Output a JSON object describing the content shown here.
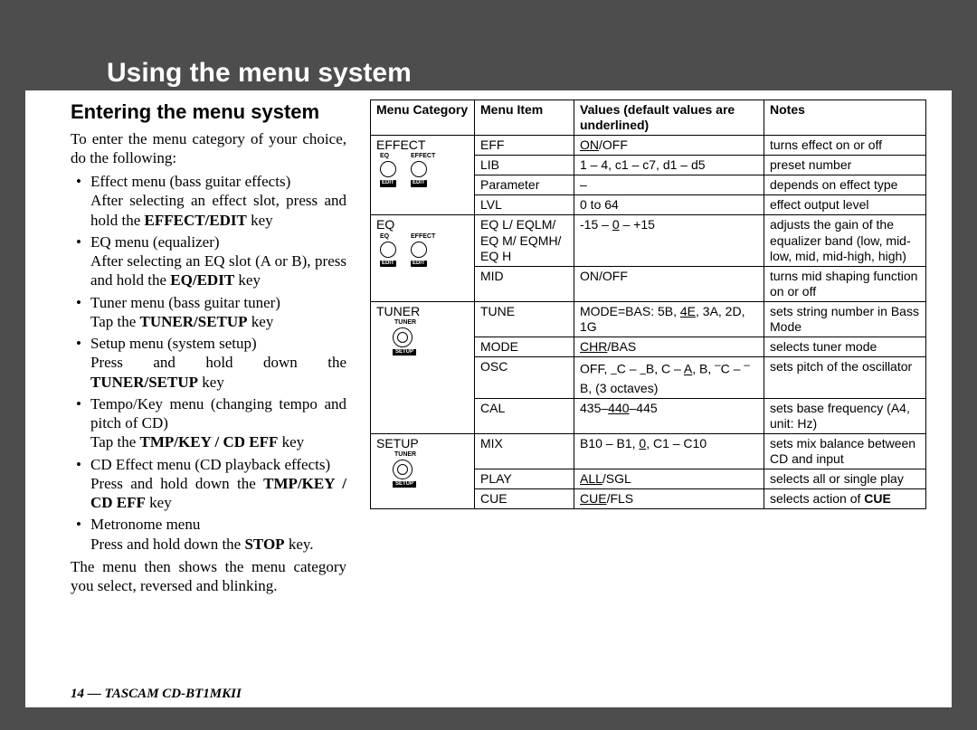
{
  "title": "Using the menu system",
  "section_heading": "Entering the menu system",
  "intro": "To enter the menu category of your choice, do the following:",
  "bullets": [
    {
      "head": "Effect menu (bass guitar effects)",
      "sub_pre": "After selecting an effect slot, press and hold the ",
      "sub_bold": "EFFECT/EDIT",
      "sub_post": " key"
    },
    {
      "head": "EQ menu (equalizer)",
      "sub_pre": "After selecting an EQ slot (A or B), press and hold the ",
      "sub_bold": "EQ/EDIT",
      "sub_post": " key"
    },
    {
      "head": "Tuner menu (bass guitar tuner)",
      "sub_pre": "Tap the ",
      "sub_bold": "TUNER/SETUP",
      "sub_post": " key"
    },
    {
      "head": "Setup menu (system setup)",
      "sub_pre": "Press and hold down the ",
      "sub_bold": "TUNER/SETUP",
      "sub_post": " key"
    },
    {
      "head": "Tempo/Key menu (changing tempo and pitch of CD)",
      "sub_pre": "Tap the ",
      "sub_bold": "TMP/KEY / CD EFF",
      "sub_post": " key"
    },
    {
      "head": "CD Effect menu (CD playback effects)",
      "sub_pre": "Press and hold down the ",
      "sub_bold": "TMP/KEY / CD EFF",
      "sub_post": " key"
    },
    {
      "head": "Metronome menu",
      "sub_pre": "Press and hold down the ",
      "sub_bold": "STOP",
      "sub_post": " key."
    }
  ],
  "outro": "The menu then shows the menu category you select, reversed and blinking.",
  "footer": {
    "page_num": "14",
    "sep": " — ",
    "product": "TASCAM CD-BT1MKII"
  },
  "table": {
    "headers": {
      "cat": "Menu Category",
      "item": "Menu Item",
      "values": "Values (default values are underlined)",
      "notes": "Notes"
    },
    "groups": [
      {
        "category": "EFFECT",
        "icon": "eq-effect-icon",
        "rows": [
          {
            "item": "EFF",
            "values_html": "<span class='u'>ON</span>/OFF",
            "notes_html": "turns effect on or off"
          },
          {
            "item": "LIB",
            "values_html": "1 – 4, c1 – c7, d1 – d5",
            "notes_html": "preset number"
          },
          {
            "item": "Parameter",
            "values_html": "–",
            "notes_html": "depends on effect type"
          },
          {
            "item": "LVL",
            "values_html": "0 to 64",
            "notes_html": "effect output level"
          }
        ]
      },
      {
        "category": "EQ",
        "icon": "eq-effect-icon",
        "rows": [
          {
            "item": "EQ L/ EQLM/ EQ M/ EQMH/ EQ H",
            "values_html": "-15 – <span class='u'>0</span> – +15",
            "notes_html": "adjusts the gain of the equalizer band (low, mid-low, mid, mid-high, high)"
          },
          {
            "item": "MID",
            "values_html": "ON/OFF",
            "notes_html": "turns mid shaping function on or off"
          }
        ]
      },
      {
        "category": "TUNER",
        "icon": "tuner-setup-icon",
        "rows": [
          {
            "item": "TUNE",
            "values_html": "MODE=BAS: 5B, <span class='u'>4E</span>, 3A, 2D, 1G",
            "notes_html": "sets string number in Bass Mode"
          },
          {
            "item": "MODE",
            "values_html": "<span class='u'>CHR</span>/BAS",
            "notes_html": "selects tuner mode"
          },
          {
            "item": "OSC",
            "values_html": "OFF, <sub>–</sub>C – <sub>–</sub>B, C – <span class='u'>A</span>, B, <sup>–</sup>C – <sup>–</sup>B, (3 octaves)",
            "notes_html": "sets pitch of the oscillator"
          },
          {
            "item": "CAL",
            "values_html": "435–<span class='u'>440</span>–445",
            "notes_html": "sets base frequency (A4, unit: Hz)"
          }
        ]
      },
      {
        "category": "SETUP",
        "icon": "tuner-setup-icon",
        "rows": [
          {
            "item": "MIX",
            "values_html": "B10 – B1, <span class='u'>0</span>, C1 – C10",
            "notes_html": "sets mix balance between CD and input"
          },
          {
            "item": "PLAY",
            "values_html": "<span class='u'>ALL</span>/SGL",
            "notes_html": "selects all or single play"
          },
          {
            "item": "CUE",
            "values_html": "<span class='u'>CUE</span>/FLS",
            "notes_html": "selects action of <b>CUE</b>"
          }
        ]
      }
    ]
  }
}
